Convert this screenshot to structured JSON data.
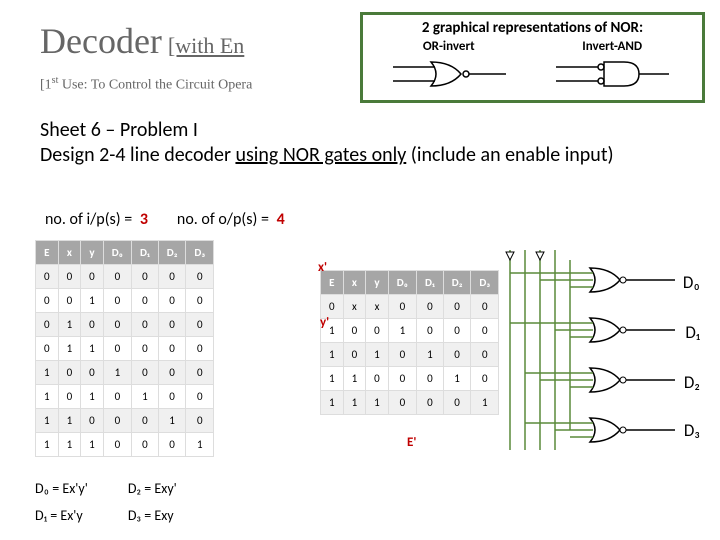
{
  "title": {
    "main": "Decoder",
    "sub": "[with En"
  },
  "subtitle": {
    "prefix": "[1",
    "sup": "st",
    "rest": " Use: To Control the Circuit Opera"
  },
  "nor_box": {
    "title": "2 graphical representations of NOR:",
    "left": "OR-invert",
    "right": "Invert-AND"
  },
  "sheet": "Sheet 6 – Problem I",
  "design": {
    "pre": "Design 2-4 line decoder ",
    "und": "using NOR gates only",
    "post": " (include an enable input)"
  },
  "io": {
    "ip_label": "no. of i/p(s) =",
    "ip_val": "3",
    "op_label": "no. of o/p(s) =",
    "op_val": "4"
  },
  "table1": {
    "headers": [
      "E",
      "x",
      "y",
      "D₀",
      "D₁",
      "D₂",
      "D₃"
    ],
    "rows": [
      [
        "0",
        "0",
        "0",
        "0",
        "0",
        "0",
        "0"
      ],
      [
        "0",
        "0",
        "1",
        "0",
        "0",
        "0",
        "0"
      ],
      [
        "0",
        "1",
        "0",
        "0",
        "0",
        "0",
        "0"
      ],
      [
        "0",
        "1",
        "1",
        "0",
        "0",
        "0",
        "0"
      ],
      [
        "1",
        "0",
        "0",
        "1",
        "0",
        "0",
        "0"
      ],
      [
        "1",
        "0",
        "1",
        "0",
        "1",
        "0",
        "0"
      ],
      [
        "1",
        "1",
        "0",
        "0",
        "0",
        "1",
        "0"
      ],
      [
        "1",
        "1",
        "1",
        "0",
        "0",
        "0",
        "1"
      ]
    ]
  },
  "table2": {
    "headers": [
      "E",
      "x",
      "y",
      "D₀",
      "D₁",
      "D₂",
      "D₃"
    ],
    "rows": [
      [
        "0",
        "x",
        "x",
        "0",
        "0",
        "0",
        "0"
      ],
      [
        "1",
        "0",
        "0",
        "1",
        "0",
        "0",
        "0"
      ],
      [
        "1",
        "0",
        "1",
        "0",
        "1",
        "0",
        "0"
      ],
      [
        "1",
        "1",
        "0",
        "0",
        "0",
        "1",
        "0"
      ],
      [
        "1",
        "1",
        "1",
        "0",
        "0",
        "0",
        "1"
      ]
    ]
  },
  "equations": {
    "d0": "D₀ = Ex'y'",
    "d2": "D₂ = Exy'",
    "d1": "D₁ = Ex'y",
    "d3": "D₃ = Exy"
  },
  "signals": {
    "xp": "x'",
    "yp": "y'",
    "ep": "E'"
  },
  "outputs": {
    "d0": "D₀",
    "d1": "D₁",
    "d2": "D₂",
    "d3": "D₃"
  }
}
